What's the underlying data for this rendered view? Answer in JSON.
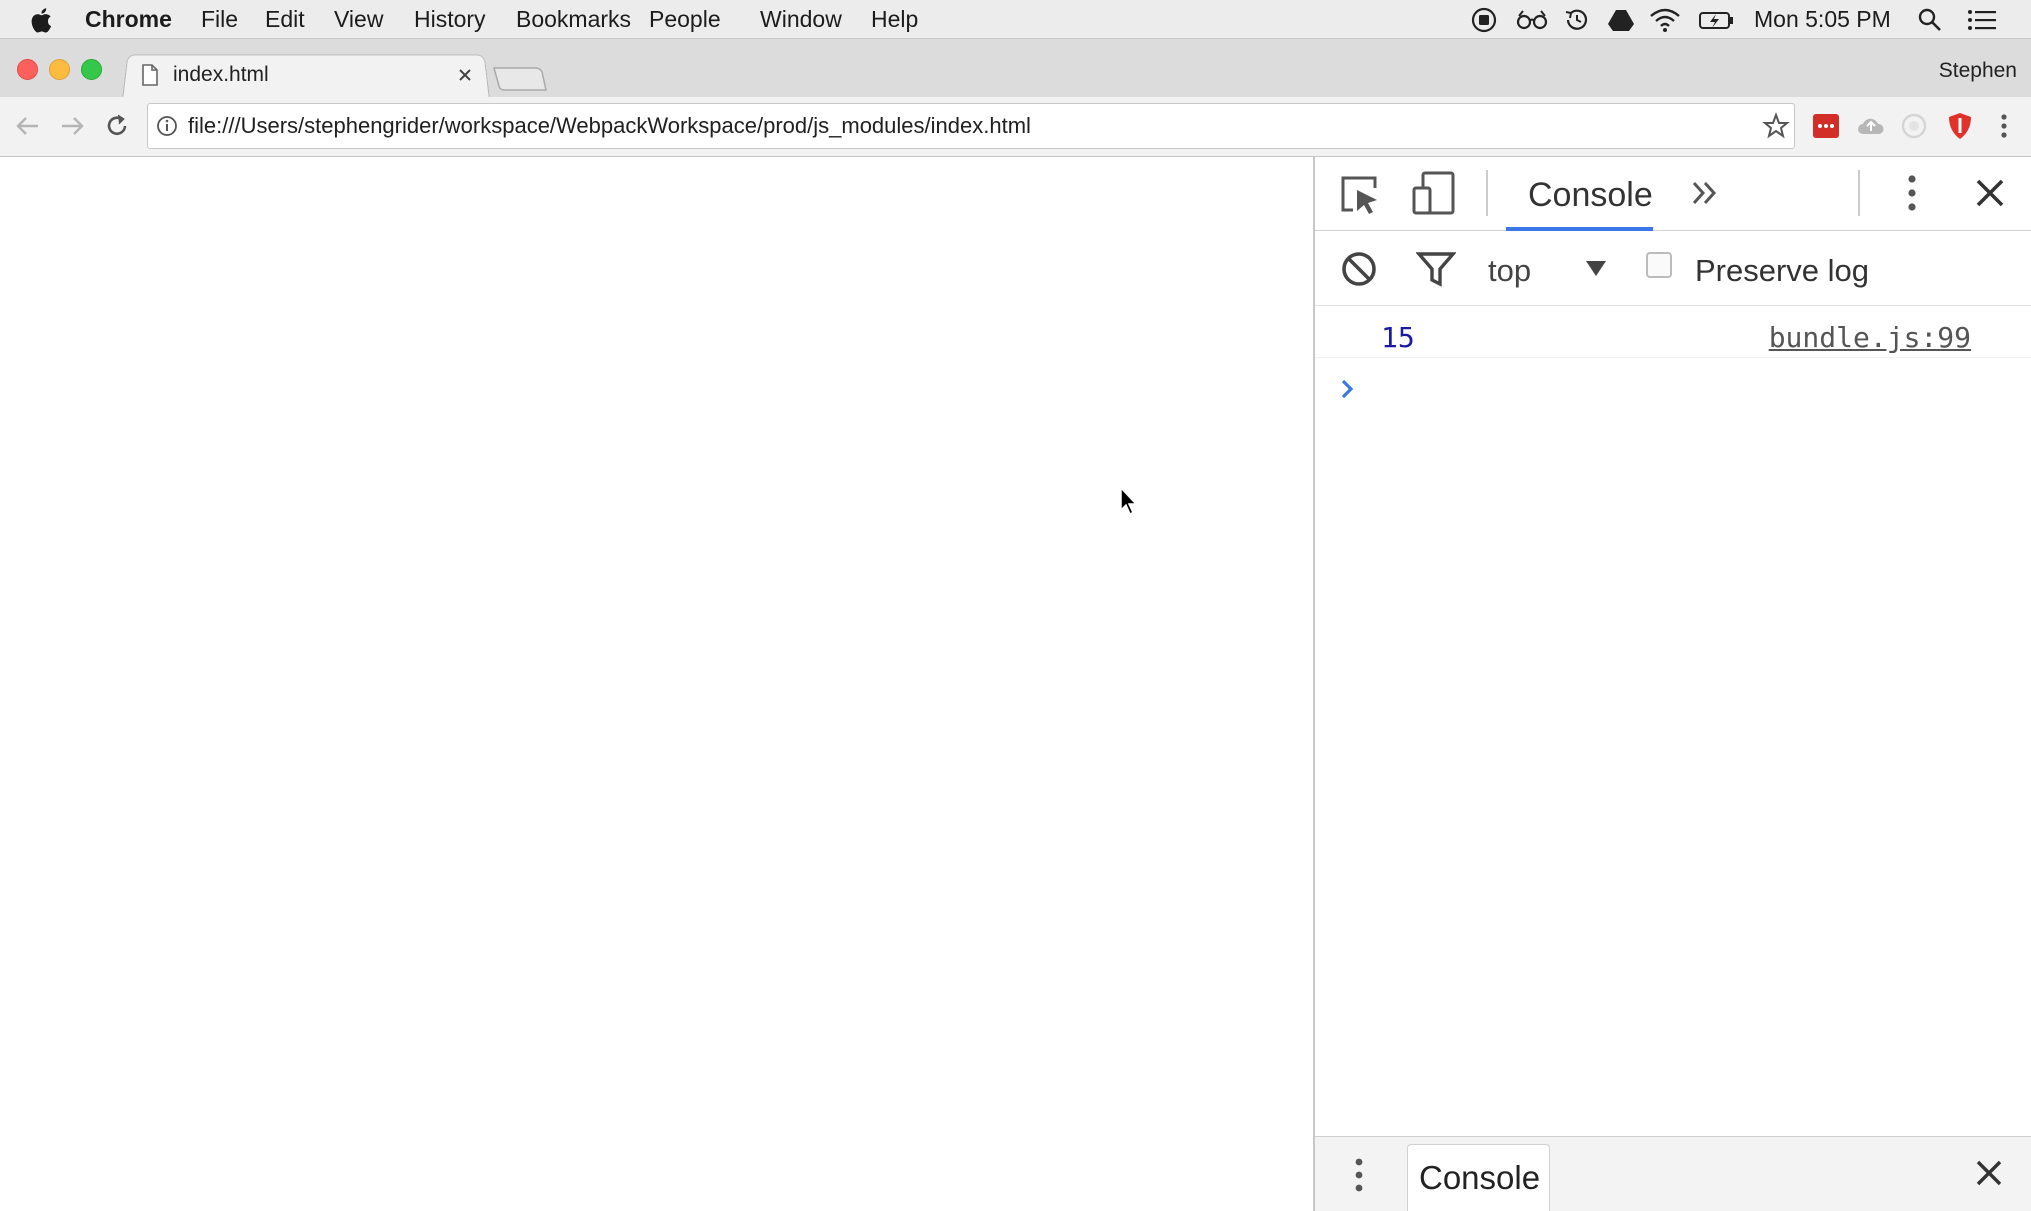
{
  "menubar": {
    "app_name": "Chrome",
    "items": [
      "File",
      "Edit",
      "View",
      "History",
      "Bookmarks",
      "People",
      "Window",
      "Help"
    ],
    "clock": "Mon 5:05 PM"
  },
  "browser": {
    "tab_title": "index.html",
    "profile_name": "Stephen",
    "url": "file:///Users/stephengrider/workspace/WebpackWorkspace/prod/js_modules/index.html"
  },
  "devtools": {
    "active_tab": "Console",
    "context_selector": "top",
    "preserve_log_label": "Preserve log",
    "preserve_log_checked": false,
    "log_entries": [
      {
        "value": "15",
        "source": "bundle.js:99"
      }
    ],
    "prompt_symbol": "›",
    "drawer_tab": "Console"
  },
  "colors": {
    "tab_underline": "#3b78e7",
    "log_number": "#1a1aa6",
    "prompt": "#3b78e7",
    "traffic_close": "#fc605c",
    "traffic_minimize": "#fdbc40",
    "traffic_zoom": "#34c84a"
  }
}
